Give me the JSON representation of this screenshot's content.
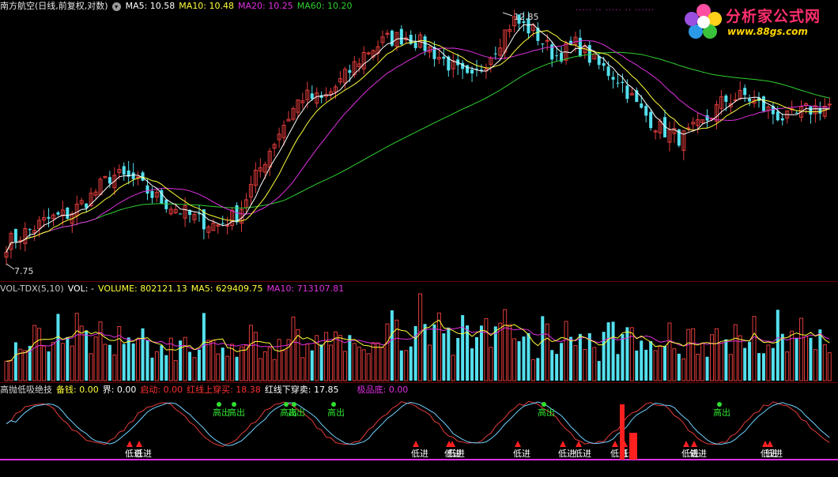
{
  "main_panel": {
    "title": "南方航空(日线,前复权,对数)",
    "ma5": "MA5: 10.58",
    "ma10": "MA10: 10.48",
    "ma20": "MA20: 10.25",
    "ma60": "MA60: 10.20",
    "high_label": "12.85",
    "low_label": "7.75"
  },
  "volume_panel": {
    "title": "VOL-TDX(5,10)",
    "vol": "VOL: -",
    "volume": "VOLUME: 802121.13",
    "ma5": "MA5: 629409.75",
    "ma10": "MA10: 713107.81"
  },
  "indicator_panel": {
    "title": "高抛低吸绝技",
    "beiqian": "备钱: 0.00",
    "jie": "界: 0.00",
    "qidong": "启动: 0.00",
    "red_up": "红线上穿买: 18.38",
    "red_down": "红线下穿卖: 17.85",
    "jipin": "极品底: 0.00",
    "buy_label": "低进",
    "sell_label": "高出"
  },
  "watermark": {
    "title": "分析家公式网",
    "url": "www.88gs.com"
  },
  "colors": {
    "up": "#e23b3b",
    "down": "#54e0ee",
    "ma5": "#ffffff",
    "ma10": "#ffff3a",
    "ma20": "#e030e0",
    "ma60": "#30d030",
    "vol_ma5": "#ffff3a",
    "vol_ma10": "#e030e0"
  },
  "chart_data": [
    {
      "type": "candlestick",
      "title": "南方航空(日线,前复权,对数)",
      "scale": "log",
      "price_high": 12.85,
      "price_low": 7.75,
      "close_series": [
        8.1,
        8.3,
        8.5,
        8.6,
        8.9,
        9.3,
        9.2,
        8.9,
        8.7,
        8.5,
        8.4,
        8.6,
        9.4,
        10.2,
        10.9,
        10.8,
        11.3,
        11.9,
        12.2,
        12.3,
        12.0,
        11.6,
        11.2,
        11.9,
        12.7,
        12.4,
        11.8,
        12.1,
        11.6,
        11.3,
        10.6,
        10.2,
        10.0,
        10.3,
        10.8,
        10.9,
        10.6,
        10.4,
        10.6,
        10.7
      ]
    },
    {
      "type": "bar",
      "title": "VOL-TDX(5,10)",
      "series": [
        {
          "name": "VOLUME",
          "value": 802121.13
        },
        {
          "name": "MA5",
          "value": 629409.75
        },
        {
          "name": "MA10",
          "value": 713107.81
        }
      ]
    },
    {
      "type": "line",
      "title": "高抛低吸绝技",
      "markers": {
        "buy": [
          164,
          176,
          526,
          568,
          572,
          655,
          712,
          732,
          778,
          790,
          868,
          878,
          968,
          974
        ],
        "sell": [
          277,
          296,
          362,
          372,
          422,
          688,
          910
        ]
      }
    }
  ]
}
